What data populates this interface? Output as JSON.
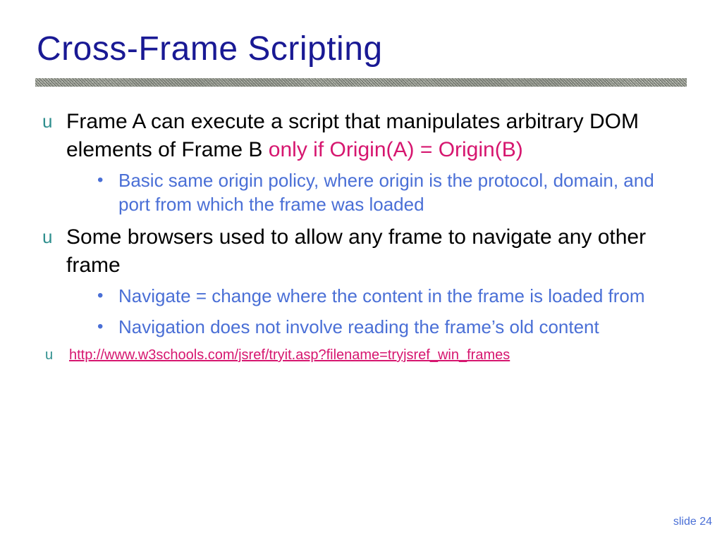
{
  "title": "Cross-Frame Scripting",
  "bullets": {
    "b1_part1": "Frame A can execute a script that manipulates arbitrary DOM elements of Frame B ",
    "b1_hl": "only if Origin(A) = Origin(B)",
    "b1_sub1": "Basic same origin policy, where origin is the protocol, domain, and port from which the frame was loaded",
    "b2": "Some browsers used to allow any frame to navigate any other frame",
    "b2_sub1": "Navigate = change where the content in the frame is loaded from",
    "b2_sub2": "Navigation does not involve reading the frame’s old content",
    "link": "http://www.w3schools.com/jsref/tryit.asp?filename=tryjsref_win_frames"
  },
  "glyphs": {
    "u": "u",
    "dot": "•"
  },
  "footer": "slide 24"
}
